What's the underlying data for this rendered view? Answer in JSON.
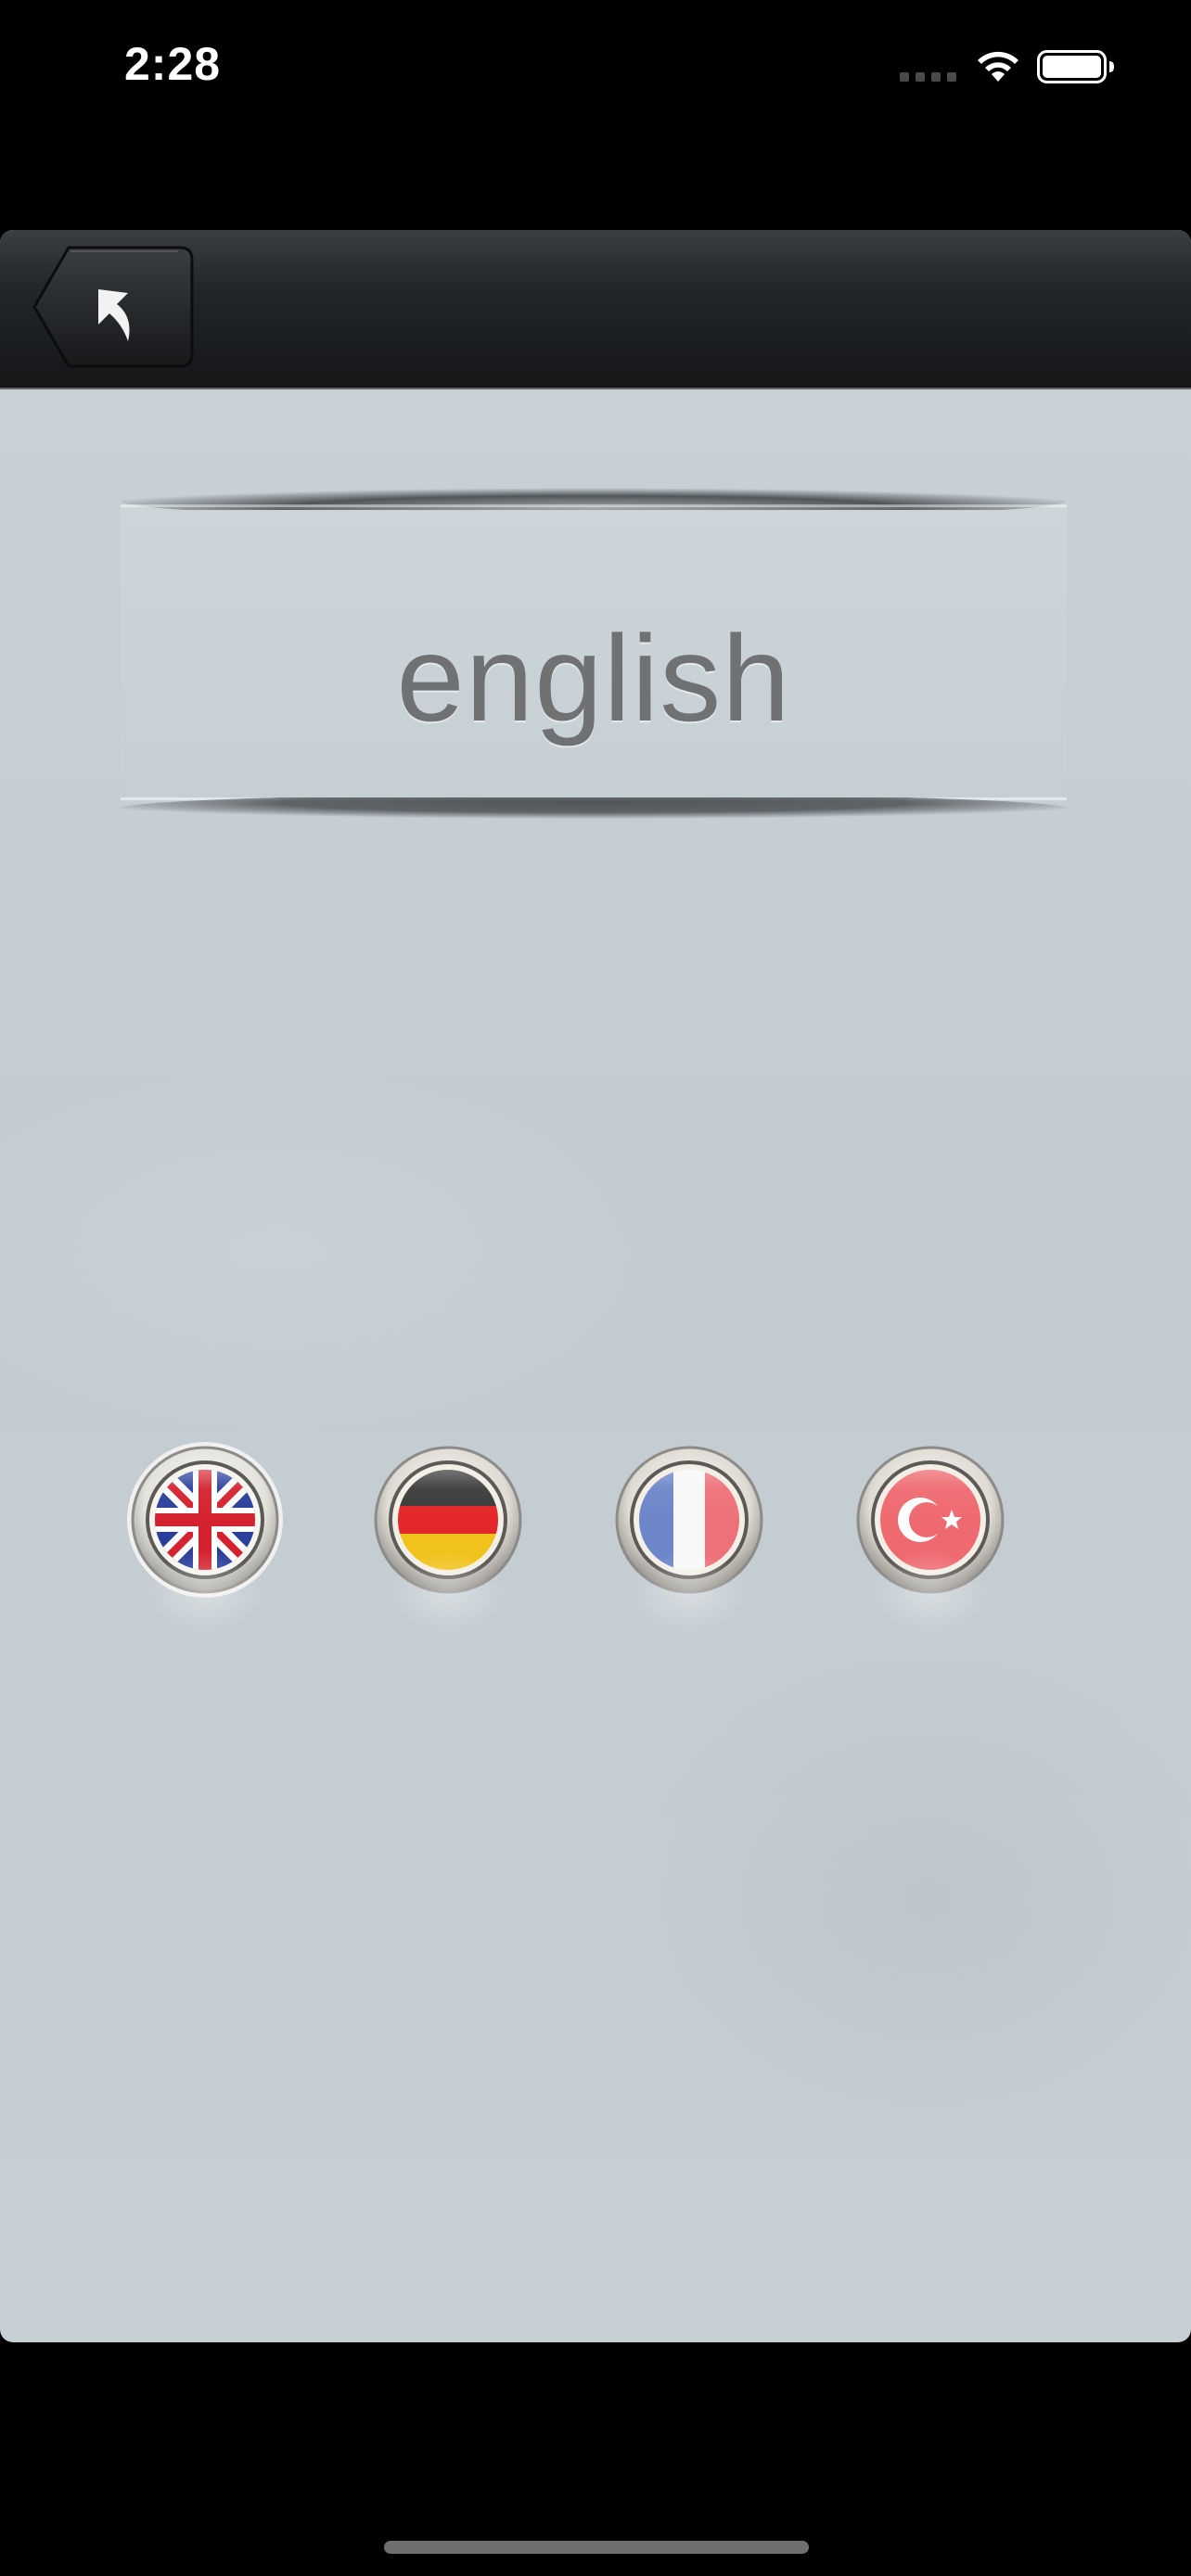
{
  "status_bar": {
    "time": "2:28",
    "icons": [
      "signal-icon",
      "wifi-icon",
      "battery-icon"
    ]
  },
  "nav": {
    "back_icon": "back-arrow-icon"
  },
  "title": {
    "text": "english"
  },
  "languages": [
    {
      "name": "english-flag",
      "icon": "uk-flag-icon",
      "selected": true
    },
    {
      "name": "german-flag",
      "icon": "germany-flag-icon",
      "selected": false
    },
    {
      "name": "french-flag",
      "icon": "france-flag-icon",
      "selected": false
    },
    {
      "name": "turkish-flag",
      "icon": "turkey-flag-icon",
      "selected": false
    }
  ],
  "colors": {
    "background": "#c6cfd4",
    "navbar": "#1d2023",
    "title_text": "#707172"
  }
}
